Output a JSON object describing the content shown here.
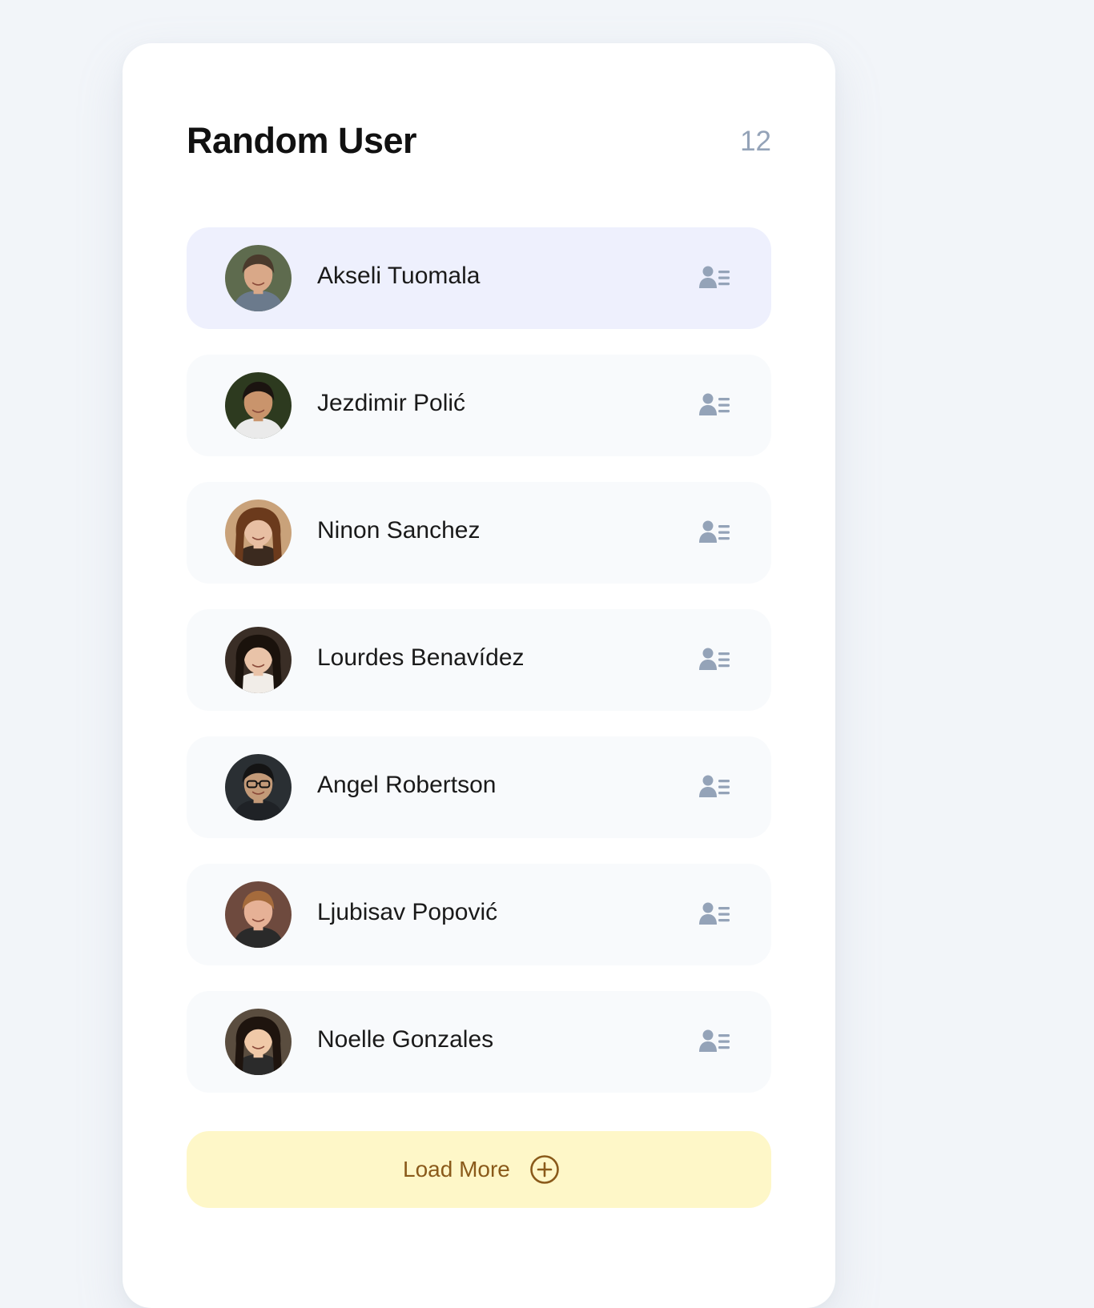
{
  "header": {
    "title": "Random User",
    "count": "12"
  },
  "users": [
    {
      "name": "Akseli Tuomala",
      "selected": true,
      "avatar": {
        "bg": "#5e6b4e",
        "skin": "#d9a888",
        "hair": "#4a3a2c",
        "shirt": "#6b7a8c",
        "style": "short"
      }
    },
    {
      "name": "Jezdimir Polić",
      "selected": false,
      "avatar": {
        "bg": "#2d3a1f",
        "skin": "#c9946c",
        "hair": "#1b1410",
        "shirt": "#eaeaea",
        "style": "short"
      }
    },
    {
      "name": "Ninon Sanchez",
      "selected": false,
      "avatar": {
        "bg": "#c9a27a",
        "skin": "#e8bfa3",
        "hair": "#6b3a1c",
        "shirt": "#3b2a1f",
        "style": "long"
      }
    },
    {
      "name": "Lourdes Benavídez",
      "selected": false,
      "avatar": {
        "bg": "#3a2e26",
        "skin": "#e9c3a8",
        "hair": "#1a120c",
        "shirt": "#f1ede8",
        "style": "long"
      }
    },
    {
      "name": "Angel Robertson",
      "selected": false,
      "avatar": {
        "bg": "#2a2f33",
        "skin": "#c39a78",
        "hair": "#141414",
        "shirt": "#1f2226",
        "style": "glasses"
      }
    },
    {
      "name": "Ljubisav Popović",
      "selected": false,
      "avatar": {
        "bg": "#6e4a3e",
        "skin": "#e6b196",
        "hair": "#a56b3c",
        "shirt": "#2a2a2a",
        "style": "short"
      }
    },
    {
      "name": "Noelle Gonzales",
      "selected": false,
      "avatar": {
        "bg": "#5a4d3f",
        "skin": "#f0c9a8",
        "hair": "#1e140e",
        "shirt": "#2b2b2b",
        "style": "long"
      }
    }
  ],
  "load_more": {
    "label": "Load More"
  },
  "icons": {
    "profile": "user-details-icon",
    "load_more": "plus-circle-icon"
  },
  "colors": {
    "page_bg": "#f2f5f9",
    "row_bg": "#f8fafc",
    "row_selected_bg": "#eef0fd",
    "icon_gray": "#94a3b8",
    "load_more_bg": "#fef7c8",
    "load_more_text": "#8a5a1a"
  }
}
